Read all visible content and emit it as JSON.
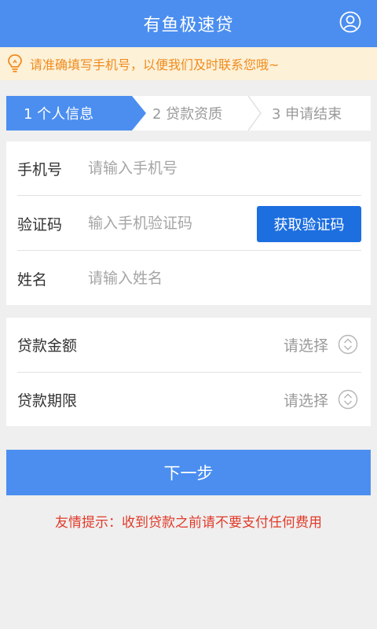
{
  "header": {
    "title": "有鱼极速贷",
    "user_icon": "user-icon"
  },
  "notice": {
    "icon": "lightbulb-icon",
    "text": "请准确填写手机号，以便我们及时联系您哦~"
  },
  "steps": [
    {
      "label": "1 个人信息",
      "active": true
    },
    {
      "label": "2 贷款资质",
      "active": false
    },
    {
      "label": "3 申请结束",
      "active": false
    }
  ],
  "form": {
    "phone": {
      "label": "手机号",
      "placeholder": "请输入手机号"
    },
    "code": {
      "label": "验证码",
      "placeholder": "输入手机验证码",
      "button": "获取验证码"
    },
    "name": {
      "label": "姓名",
      "placeholder": "请输入姓名"
    }
  },
  "loan": {
    "amount": {
      "label": "贷款金额",
      "value": "请选择"
    },
    "term": {
      "label": "贷款期限",
      "value": "请选择"
    }
  },
  "next_button": "下一步",
  "tip": "友情提示：收到贷款之前请不要支付任何费用",
  "colors": {
    "primary": "#4b8ef0",
    "button": "#1d6fe0",
    "warning": "#f08c1e",
    "tip": "#e03b2a"
  }
}
